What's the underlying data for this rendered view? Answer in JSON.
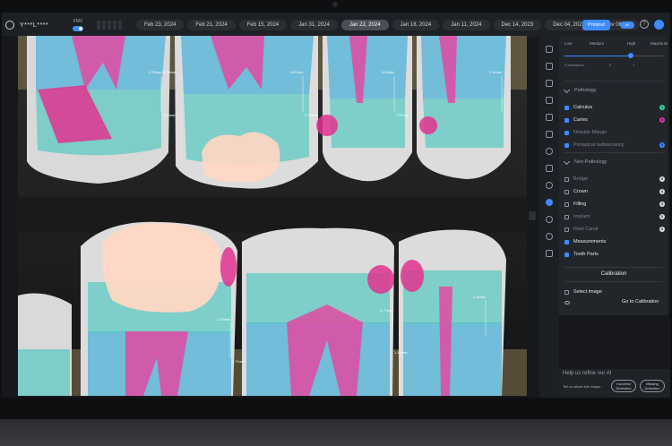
{
  "header": {
    "user_name": "Y***L****",
    "fmx_label": "FMX",
    "dates": [
      "Feb 23, 2024",
      "Feb 21, 2024",
      "Feb 15, 2024",
      "Jan 31, 2024",
      "Jan 22, 2024",
      "Jan 18, 2024",
      "Jan 11, 2024",
      "Dec 14, 2023",
      "Dec 04, 2023",
      "Nov 06, 20"
    ],
    "active_date_index": 4,
    "printout_label": "Printout",
    "ai_toggle_label": "AI",
    "help_label": "?"
  },
  "viewer": {
    "measurements": [
      "2.78mm 0.78mm",
      "0.87mm",
      "0.50mm",
      "2.34mm",
      "3.10mm",
      "0.77mm",
      "1.43mm",
      "3.16mm",
      "0.75mm",
      "1.57mm",
      "2.71mm",
      "1.16mm"
    ]
  },
  "confidence": {
    "levels": [
      "Low",
      "Medium",
      "High",
      "Maximum"
    ],
    "value": "High",
    "detections_text": "9 detections",
    "level_counts": [
      "2",
      "1"
    ]
  },
  "pathology": {
    "title": "Pathology",
    "items": [
      {
        "label": "Calculus",
        "checked": true,
        "count": "1",
        "color": "#2fd3a5",
        "dim": false
      },
      {
        "label": "Caries",
        "checked": true,
        "count": "5",
        "color": "#d33bb0",
        "dim": false
      },
      {
        "label": "Notable Margin",
        "checked": true,
        "count": "",
        "color": "",
        "dim": true
      },
      {
        "label": "Periapical radiolucency",
        "checked": true,
        "count": "0",
        "color": "#3d8bfd",
        "dim": true
      }
    ]
  },
  "non_pathology": {
    "title": "Non-Pathology",
    "items": [
      {
        "label": "Bridge",
        "checked": false,
        "count": "0",
        "dim": true
      },
      {
        "label": "Crown",
        "checked": false,
        "count": "3",
        "dim": false
      },
      {
        "label": "Filling",
        "checked": false,
        "count": "3",
        "dim": false
      },
      {
        "label": "Implant",
        "checked": false,
        "count": "0",
        "dim": true
      },
      {
        "label": "Root Canal",
        "checked": false,
        "count": "0",
        "dim": true
      },
      {
        "label": "Measurements",
        "checked": true,
        "count": "",
        "dim": false
      },
      {
        "label": "Tooth Parts",
        "checked": true,
        "count": "",
        "dim": false
      }
    ]
  },
  "calibration": {
    "title": "Calibration",
    "select_image_label": "Select image",
    "goto_label": "Go to Calibration"
  },
  "refine": {
    "title": "Help us refine our AI",
    "tell_text": "Tell us about this image:",
    "incorrect_label": "Incorrect Detection",
    "missing_label": "Missing Detection"
  },
  "colors": {
    "accent": "#3d8bfd",
    "enamel_overlay": "#56c7c0",
    "pulp_overlay": "#e24aa2",
    "root_overlay": "#4fb3d8",
    "filling_overlay": "#ffd7c4",
    "caries_overlay": "#e0338f"
  }
}
